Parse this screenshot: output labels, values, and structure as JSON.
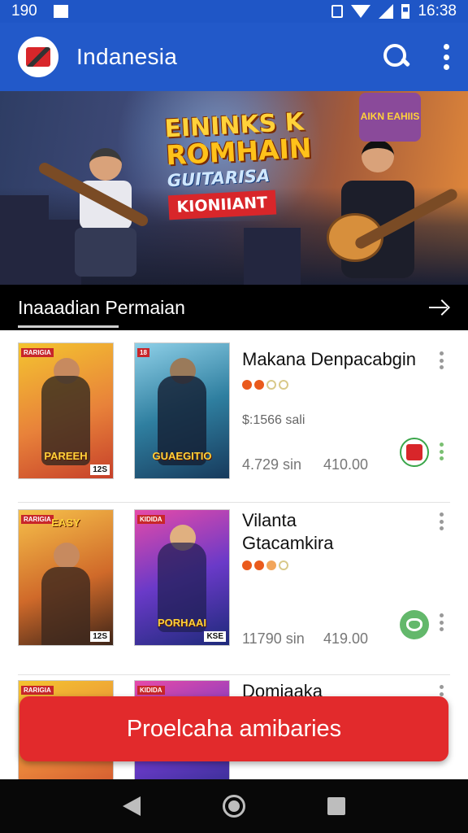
{
  "status_bar": {
    "left_text": "190",
    "time": "16:38"
  },
  "app_bar": {
    "title": "Indanesia",
    "icons": [
      "logo",
      "search-icon",
      "more-vert-icon"
    ]
  },
  "banner": {
    "line1": "EININKS K",
    "line2": "ROMHAIN",
    "line3": "GUITARISA",
    "line4": "KIONIIANT",
    "corner_badge": "AIKN EAHIIS",
    "dots_count": 4,
    "active_dot": 1
  },
  "section": {
    "title": "Inaaadian  Permaian",
    "arrow_icon": "arrow-right-icon"
  },
  "items": [
    {
      "title_line1": "Makana Denpacabgin",
      "title_line2": "",
      "rating": [
        "on",
        "on",
        "off",
        "off"
      ],
      "price": "$:1566 sali",
      "meta_a": "4.729 sin",
      "meta_b": "410.00",
      "cover_left": {
        "tag": "RARIGIA",
        "caption": "PAREEH",
        "age": "12S"
      },
      "cover_right": {
        "tag": "18",
        "caption": "GUAEGITIO"
      },
      "badge": "red"
    },
    {
      "title_line1": "Vilanta",
      "title_line2": "Gtacamkira",
      "rating": [
        "on",
        "on",
        "half",
        "off"
      ],
      "price": "",
      "meta_a": "11790 sin",
      "meta_b": "419.00",
      "cover_left": {
        "tag": "RARIGIA",
        "caption": "EASY",
        "age": "12S"
      },
      "cover_right": {
        "tag": "KIDIDA",
        "caption": "PORHAAI",
        "age": "KSE"
      },
      "badge": "green"
    },
    {
      "title_line1": "Domiaaka",
      "title_line2": "",
      "rating": [],
      "price": "",
      "meta_a": "",
      "meta_b": "",
      "cover_left": {
        "tag": "RARIGIA",
        "caption": ""
      },
      "cover_right": {
        "tag": "KIDIDA",
        "caption": ""
      },
      "badge": ""
    }
  ],
  "cta": {
    "label": "Proelcaha amibaries",
    "color": "#e22a2c"
  },
  "nav": {
    "icons": [
      "back-icon",
      "home-icon",
      "recents-icon"
    ]
  },
  "colors": {
    "primary": "#2259c9",
    "accent": "#e22a2c",
    "section_bg": "#000000"
  }
}
